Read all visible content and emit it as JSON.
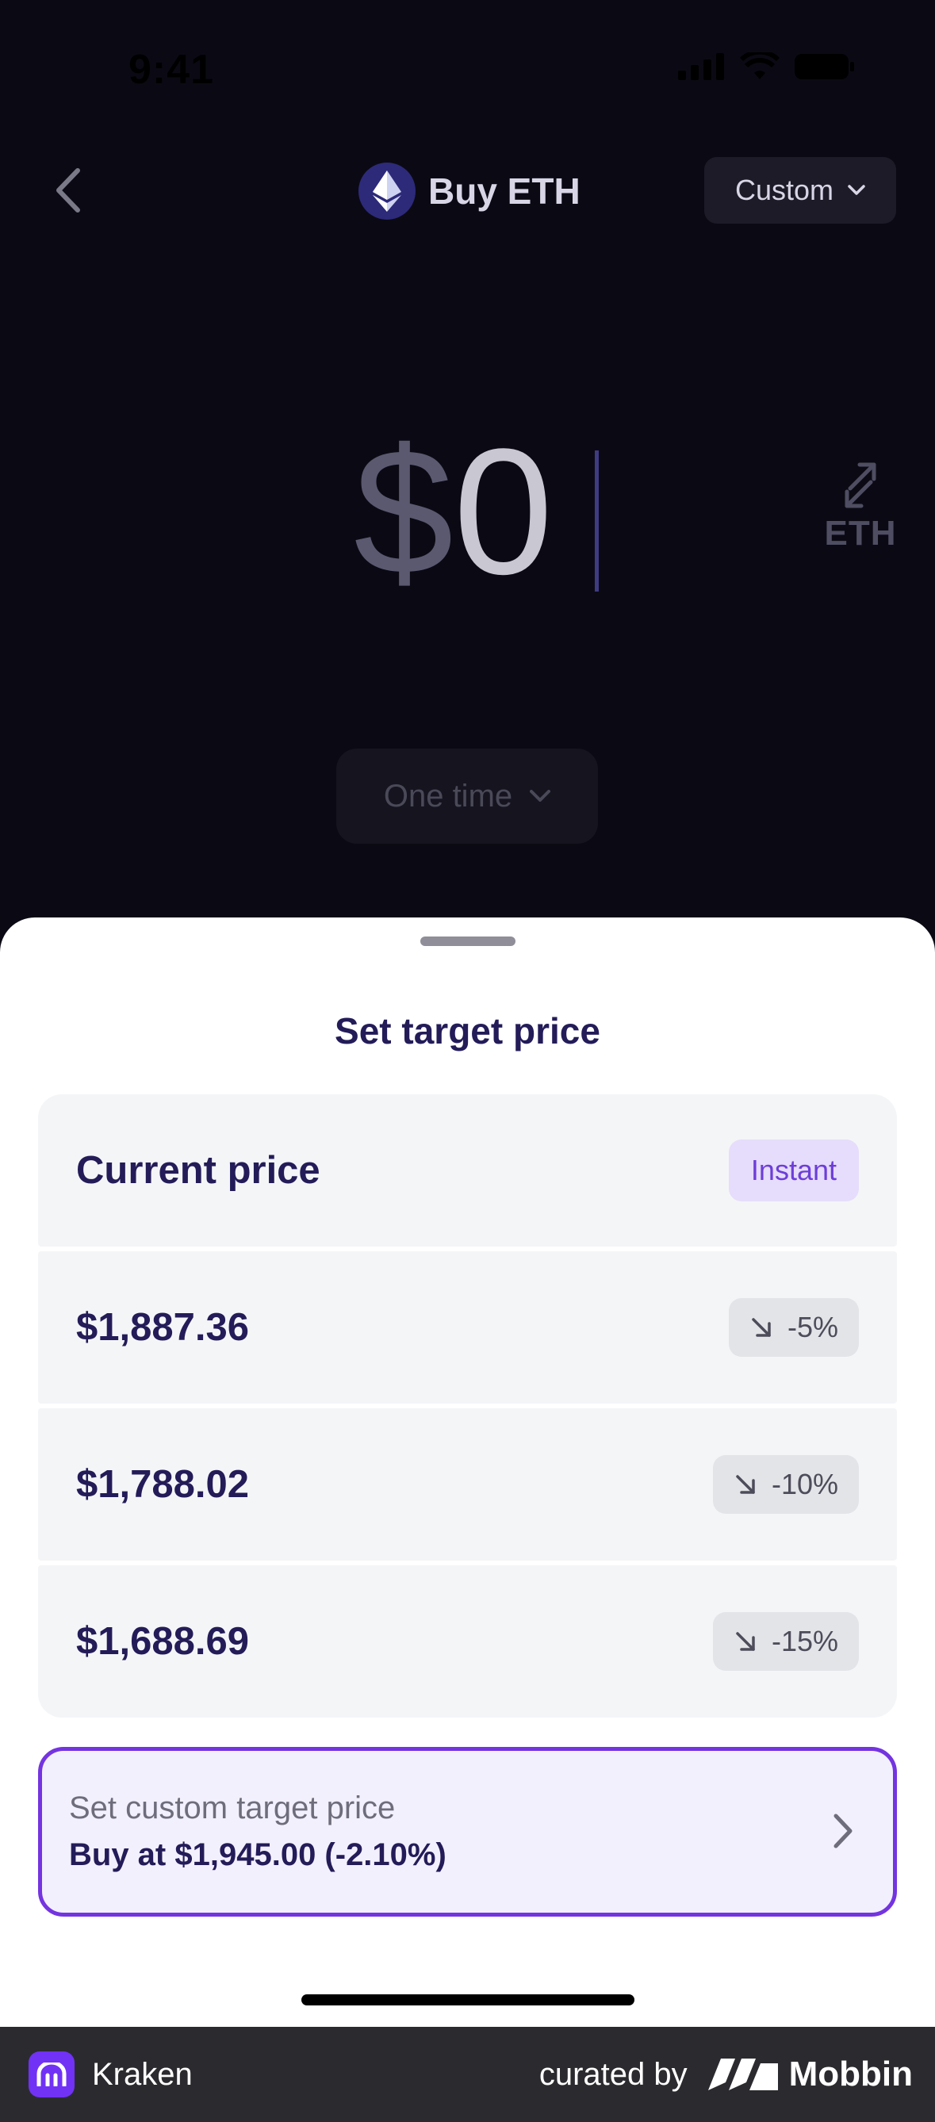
{
  "status_bar": {
    "time": "9:41"
  },
  "header": {
    "title": "Buy ETH",
    "back_icon": "chevron-left-icon",
    "asset_icon": "ethereum-icon",
    "order_type": "Custom"
  },
  "amount": {
    "currency_symbol": "$",
    "value": "0",
    "toggle_unit": "ETH"
  },
  "frequency": {
    "label": "One time"
  },
  "sheet": {
    "title": "Set target price",
    "options": [
      {
        "label": "Current price",
        "tag": "Instant"
      },
      {
        "label": "$1,887.36",
        "change": "-5%"
      },
      {
        "label": "$1,788.02",
        "change": "-10%"
      },
      {
        "label": "$1,688.69",
        "change": "-15%"
      }
    ],
    "custom": {
      "title": "Set custom target price",
      "subtitle": "Buy at $1,945.00 (-2.10%)"
    }
  },
  "footer": {
    "app_name": "Kraken",
    "curated_by": "curated by",
    "brand": "Mobbin"
  },
  "colors": {
    "background": "#0b0a14",
    "accent": "#7434e0",
    "title_text": "#231c58",
    "kraken_purple": "#7132f5"
  }
}
